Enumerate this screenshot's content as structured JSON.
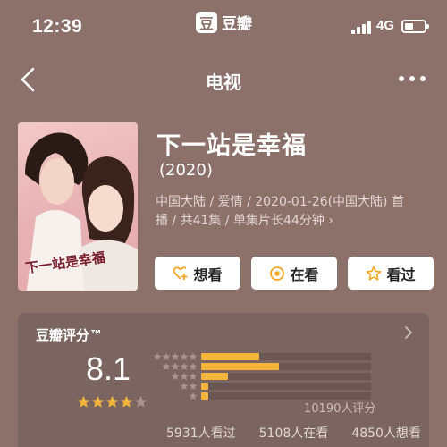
{
  "status_bar": {
    "time": "12:39",
    "network": "4G",
    "app_name": "豆瓣",
    "app_icon_char": "豆"
  },
  "nav": {
    "title": "电视"
  },
  "movie": {
    "title": "下一站是幸福",
    "year": "(2020)",
    "meta_line1": "中国大陆 / 爱情 / 2020-01-26(中国大陆) 首",
    "meta_line2": "播 / 共41集 / 单集片长44分钟",
    "meta_chevron": "›",
    "poster_text": "下一站是幸福"
  },
  "actions": [
    {
      "label": "想看",
      "icon": "heart-plus-icon"
    },
    {
      "label": "在看",
      "icon": "eye-circle-icon"
    },
    {
      "label": "看过",
      "icon": "star-outline-icon"
    }
  ],
  "rating": {
    "header": "豆瓣评分™",
    "score": "8.1",
    "stars": 4,
    "distribution": [
      {
        "stars": 5,
        "fraction": 0.34
      },
      {
        "stars": 4,
        "fraction": 0.46
      },
      {
        "stars": 3,
        "fraction": 0.16
      },
      {
        "stars": 2,
        "fraction": 0.04
      },
      {
        "stars": 1,
        "fraction": 0.04
      }
    ],
    "count_label": "10190人评分",
    "watched": "5931人看过",
    "watching": "5108人在看",
    "want": "4850人想看"
  },
  "colors": {
    "background": "#8c706a",
    "accent": "#f5b53a",
    "card": "#7a6560"
  }
}
